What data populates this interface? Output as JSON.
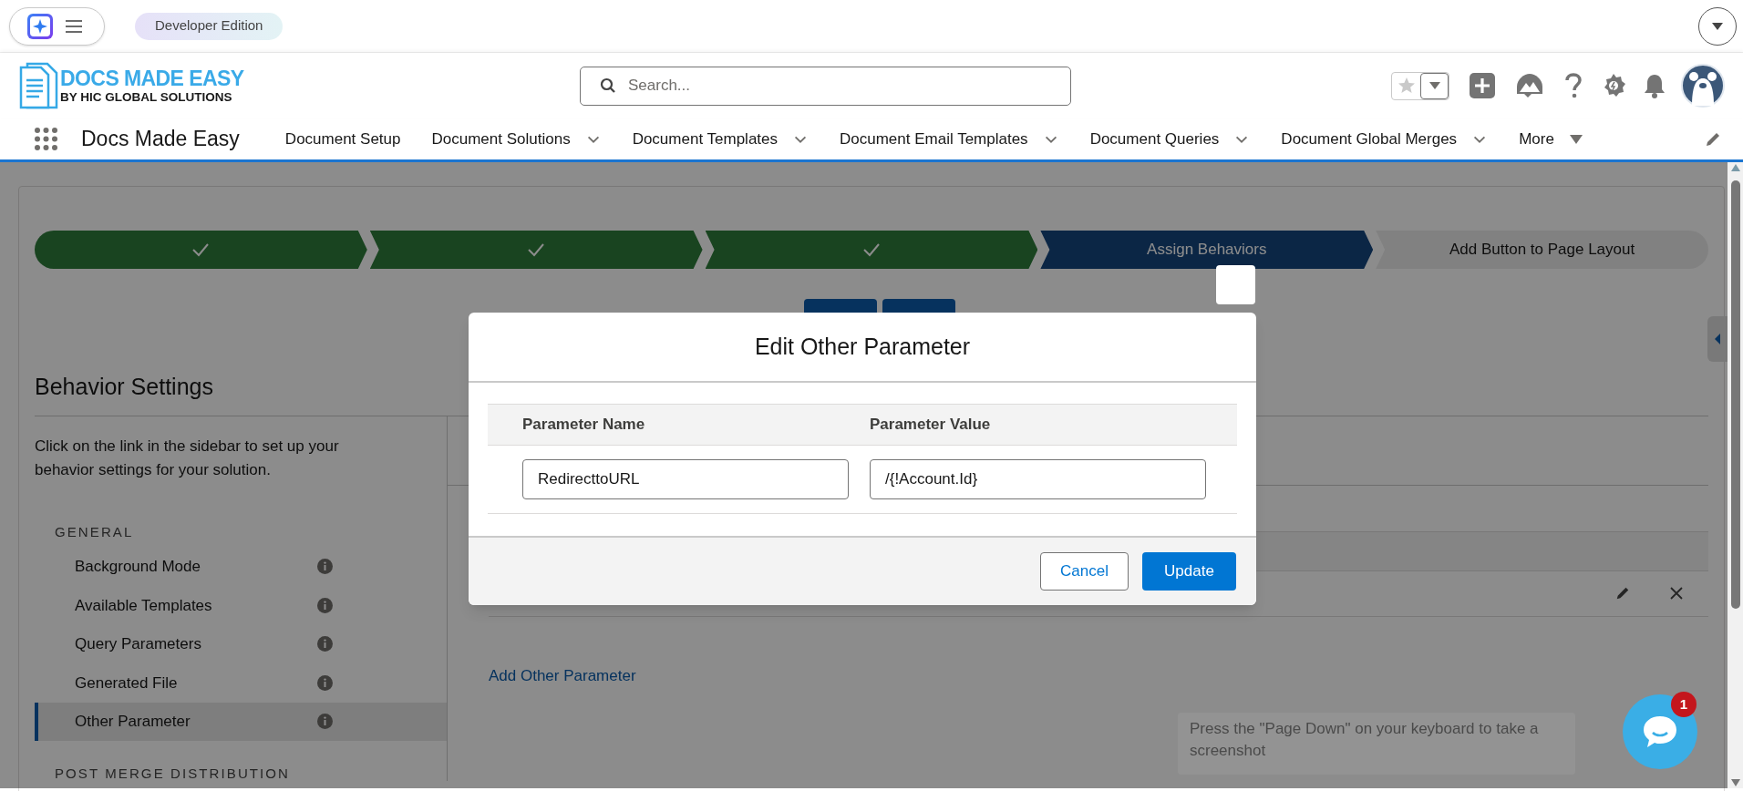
{
  "top_bar": {
    "edition_badge": "Developer Edition"
  },
  "header": {
    "logo": {
      "title": "DOCS MADE EASY",
      "subtitle": "BY HIC GLOBAL SOLUTIONS"
    },
    "search": {
      "placeholder": "Search..."
    }
  },
  "nav": {
    "app_name": "Docs Made Easy",
    "items": [
      {
        "label": "Document Setup",
        "kind": "link"
      },
      {
        "label": "Document Solutions",
        "kind": "menu"
      },
      {
        "label": "Document Templates",
        "kind": "menu"
      },
      {
        "label": "Document Email Templates",
        "kind": "menu"
      },
      {
        "label": "Document Queries",
        "kind": "menu"
      },
      {
        "label": "Document Global Merges",
        "kind": "menu"
      },
      {
        "label": "More",
        "kind": "overflow"
      }
    ]
  },
  "path": {
    "steps": [
      {
        "completed": true,
        "current": false
      },
      {
        "completed": true,
        "current": false
      },
      {
        "completed": true,
        "current": false
      },
      {
        "completed": false,
        "current": true,
        "label": "Assign Behaviors"
      },
      {
        "completed": false,
        "current": false,
        "label": "Add Button to Page Layout"
      }
    ]
  },
  "behavior_settings": {
    "title": "Behavior Settings",
    "description": "Click on the link in the sidebar to set up your behavior settings for your solution.",
    "sections": [
      {
        "heading": "GENERAL",
        "items": [
          {
            "label": "Background Mode",
            "selected": false
          },
          {
            "label": "Available Templates",
            "selected": false
          },
          {
            "label": "Query Parameters",
            "selected": false
          },
          {
            "label": "Generated File",
            "selected": false
          },
          {
            "label": "Other Parameter",
            "selected": true
          }
        ]
      },
      {
        "heading": "POST MERGE DISTRIBUTION"
      }
    ]
  },
  "other_parameters": {
    "add_link": "Add Other Parameter"
  },
  "modal": {
    "title": "Edit Other Parameter",
    "columns": [
      "Parameter Name",
      "Parameter Value"
    ],
    "row": {
      "name": "RedirecttoURL",
      "value": "/{!Account.Id}"
    },
    "buttons": [
      {
        "label": "Cancel",
        "kind": "neutral"
      },
      {
        "label": "Update",
        "kind": "brand"
      }
    ]
  },
  "tooltip": "Press the \"Page Down\" on your keyboard to take a screenshot",
  "chat": {
    "badge": "1"
  }
}
